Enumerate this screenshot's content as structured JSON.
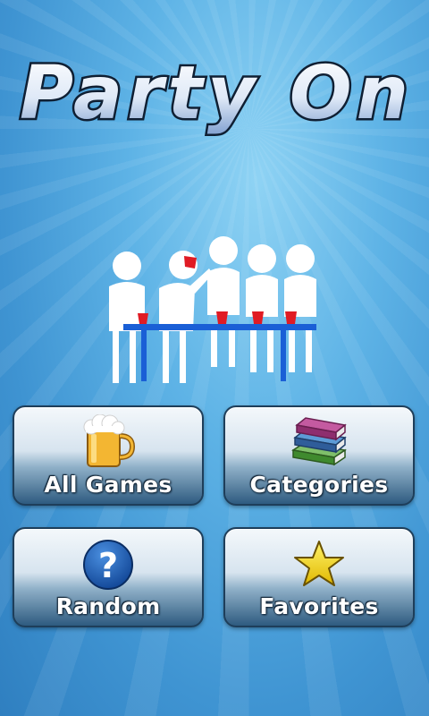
{
  "app": {
    "title": "Party On"
  },
  "menu": {
    "buttons": [
      {
        "label": "All Games",
        "icon": "beer-mug-icon"
      },
      {
        "label": "Categories",
        "icon": "books-icon"
      },
      {
        "label": "Random",
        "icon": "question-mark-icon"
      },
      {
        "label": "Favorites",
        "icon": "star-icon"
      }
    ]
  },
  "colors": {
    "background": "#4fa3dc",
    "table": "#1a5fd6",
    "cups": "#e01b24",
    "button_dark": "#2e5b80"
  }
}
